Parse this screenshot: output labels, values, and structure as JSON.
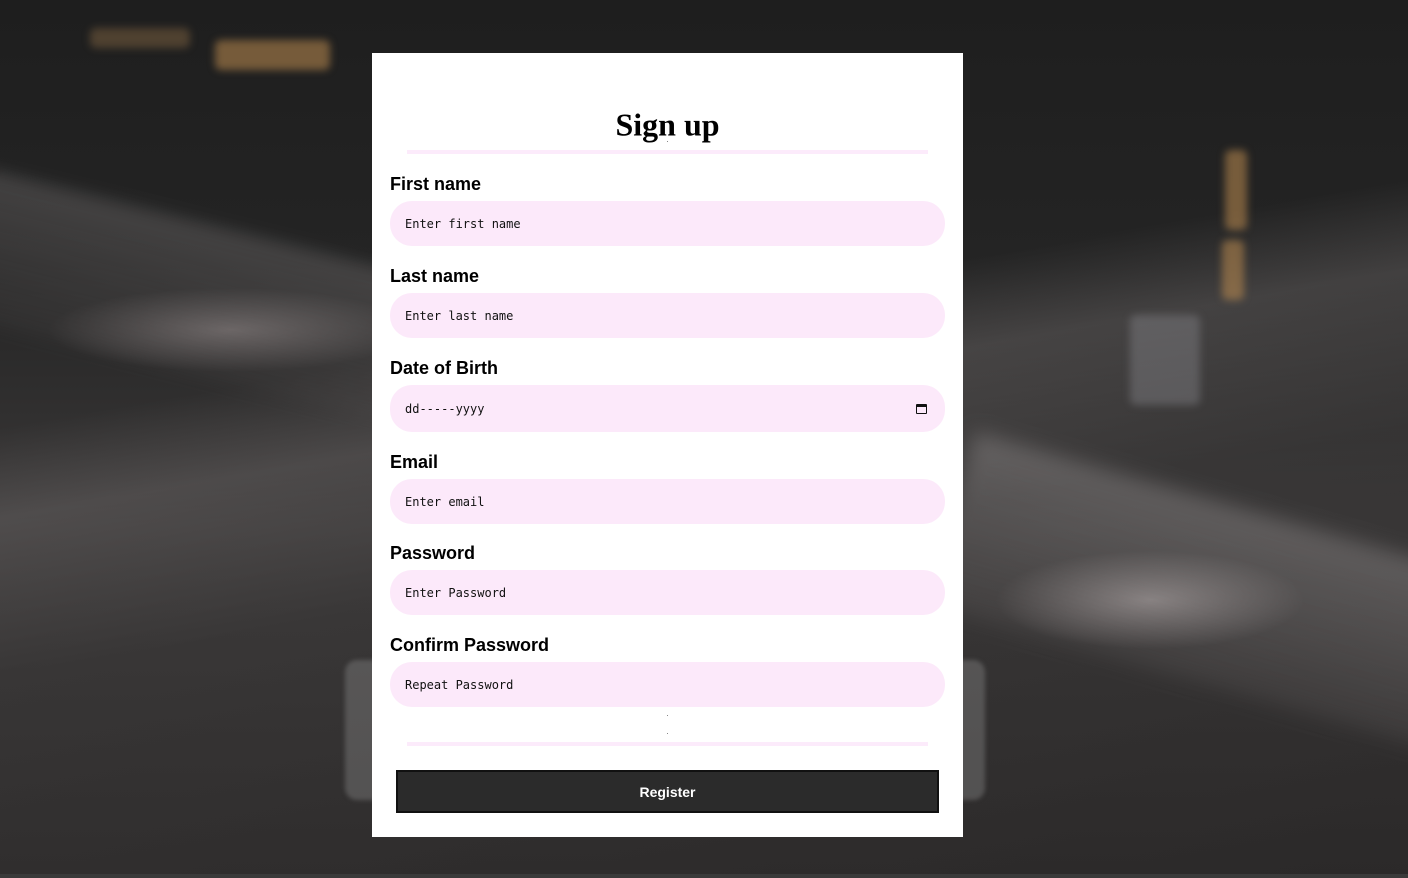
{
  "form": {
    "title": "Sign up",
    "fields": [
      {
        "label": "First name",
        "placeholder": "Enter first name"
      },
      {
        "label": "Last name",
        "placeholder": "Enter last name"
      },
      {
        "label": "Date of Birth",
        "placeholder": "dd-----yyyy"
      },
      {
        "label": "Email",
        "placeholder": "Enter email"
      },
      {
        "label": "Password",
        "placeholder": "Enter Password"
      },
      {
        "label": "Confirm Password",
        "placeholder": "Repeat Password"
      }
    ],
    "submit_label": "Register"
  },
  "icons": {
    "date_picker": "calendar-icon"
  },
  "colors": {
    "card_background": "#ffffff",
    "field_background": "#fce9fa",
    "divider": "#fcebfb",
    "button_background": "#2b2b2b",
    "button_text": "#ffffff"
  }
}
